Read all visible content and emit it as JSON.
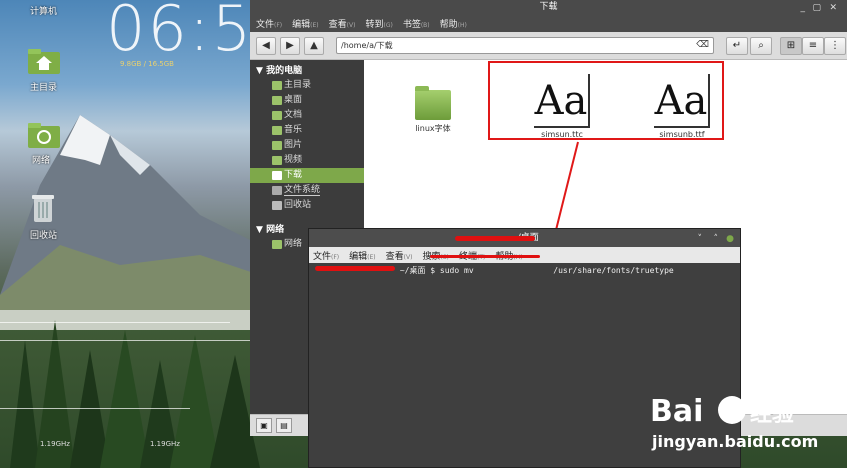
{
  "desktop": {
    "top_label": "计算机",
    "clock": "06:5",
    "memory": "9.8GB / 16.5GB",
    "icons": [
      {
        "label": "主目录",
        "icon": "home-folder-icon"
      },
      {
        "label": "网络",
        "icon": "network-icon"
      },
      {
        "label": "回收站",
        "icon": "trash-icon"
      }
    ],
    "widget_labels": [
      "1.19GHz",
      "1.19GHz"
    ]
  },
  "file_manager": {
    "title": "下载",
    "menu": [
      {
        "label": "文件",
        "key": "(F)"
      },
      {
        "label": "编辑",
        "key": "(E)"
      },
      {
        "label": "查看",
        "key": "(V)"
      },
      {
        "label": "转到",
        "key": "(G)"
      },
      {
        "label": "书签",
        "key": "(B)"
      },
      {
        "label": "帮助",
        "key": "(H)"
      }
    ],
    "address": "/home/a/下载",
    "sidebar": {
      "computer_header": "我的电脑",
      "computer_items": [
        {
          "label": "主目录",
          "selected": false
        },
        {
          "label": "桌面",
          "selected": false
        },
        {
          "label": "文档",
          "selected": false
        },
        {
          "label": "音乐",
          "selected": false
        },
        {
          "label": "图片",
          "selected": false
        },
        {
          "label": "视频",
          "selected": false
        },
        {
          "label": "下载",
          "selected": true
        },
        {
          "label": "文件系统",
          "selected": false
        },
        {
          "label": "回收站",
          "selected": false
        }
      ],
      "network_header": "网络",
      "network_items": [
        {
          "label": "网络",
          "selected": false
        }
      ]
    },
    "files": [
      {
        "name": "linux字体",
        "type": "folder"
      },
      {
        "name": "simsun.ttc",
        "type": "font",
        "glyph": "Aa"
      },
      {
        "name": "simsunb.ttf",
        "type": "font",
        "glyph": "Aa"
      }
    ]
  },
  "terminal": {
    "title": "~/桌面",
    "menu": [
      {
        "label": "文件",
        "key": "(F)"
      },
      {
        "label": "编辑",
        "key": "(E)"
      },
      {
        "label": "查看",
        "key": "(V)"
      },
      {
        "label": "搜索",
        "key": "(S)"
      },
      {
        "label": "终端",
        "key": "(T)"
      },
      {
        "label": "帮助",
        "key": "(H)"
      }
    ],
    "prompt_path": "~/桌面 $",
    "command": "sudo mv",
    "command_dest": "/usr/share/fonts/truetype"
  },
  "watermark": {
    "brand": "Bai",
    "brand_cn": "经验",
    "url": "jingyan.baidu.com"
  },
  "colors": {
    "accent_green": "#7ea84a",
    "highlight_red": "#e01818"
  }
}
